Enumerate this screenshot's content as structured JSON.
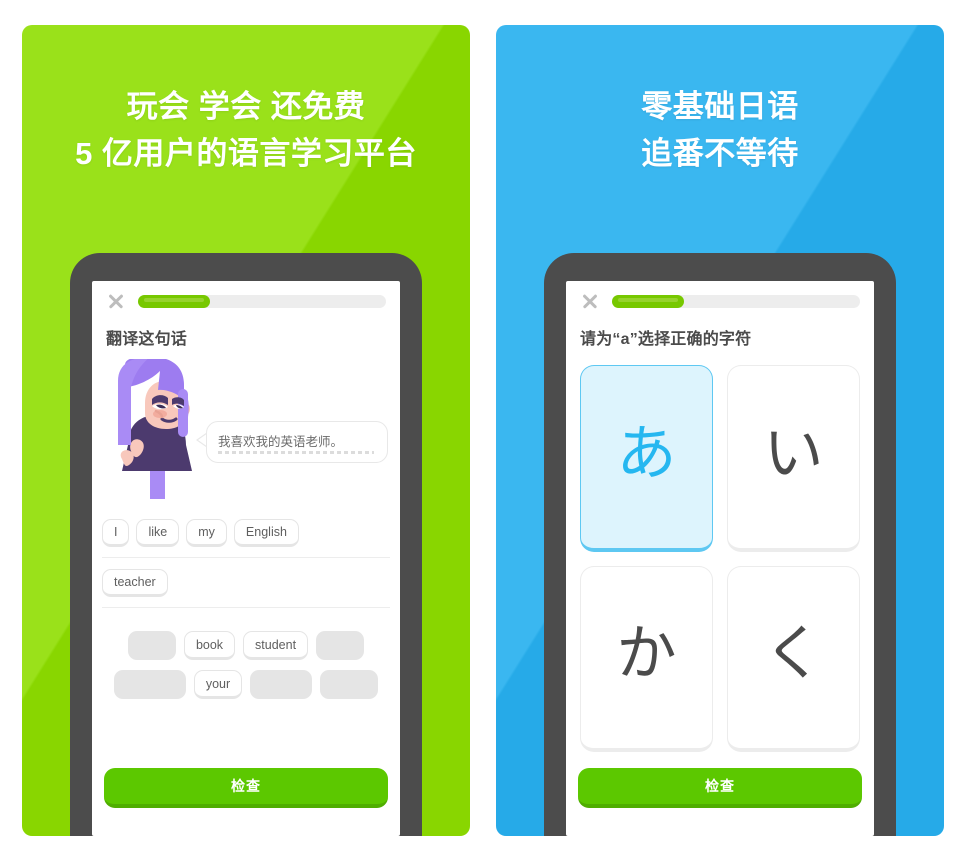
{
  "panels": [
    {
      "id": "left",
      "accent_color": "#8ede00",
      "headline_line1": "玩会 学会 还免费",
      "headline_line2": "5 亿用户的语言学习平台",
      "phone": {
        "close_icon": "close-x-icon",
        "progress_percent": 29,
        "prompt": "翻译这句话",
        "illustration": {
          "character_name": "purple-haired-character",
          "hair_color": "#a98bf5",
          "skin_color": "#f8c8bc",
          "shirt_color": "#4c3a6e",
          "speech_bubble_text": "我喜欢我的英语老师。"
        },
        "answer_rows": [
          [
            "I",
            "like",
            "my",
            "English"
          ],
          [
            "teacher"
          ]
        ],
        "word_bank_rows": [
          [
            {
              "label": "",
              "blank": true,
              "size": "w1"
            },
            {
              "label": "book",
              "blank": false
            },
            {
              "label": "student",
              "blank": false
            },
            {
              "label": "",
              "blank": true,
              "size": "w1"
            }
          ],
          [
            {
              "label": "",
              "blank": true,
              "size": "w2"
            },
            {
              "label": "your",
              "blank": false
            },
            {
              "label": "",
              "blank": true,
              "size": "w3"
            },
            {
              "label": "",
              "blank": true,
              "size": "w4"
            }
          ]
        ],
        "check_label": "检查"
      }
    },
    {
      "id": "right",
      "accent_color": "#27b0ef",
      "headline_line1": "零基础日语",
      "headline_line2": "追番不等待",
      "phone": {
        "close_icon": "close-x-icon",
        "progress_percent": 29,
        "prompt": "请为“a”选择正确的字符",
        "choices": [
          {
            "char": "あ",
            "selected": true
          },
          {
            "char": "い",
            "selected": false
          },
          {
            "char": "か",
            "selected": false
          },
          {
            "char": "く",
            "selected": false
          }
        ],
        "check_label": "检查"
      }
    }
  ],
  "colors": {
    "green_brand": "#8ede00",
    "blue_brand": "#27b0ef",
    "check_button": "#5cc800",
    "progress_fill": "#77c800",
    "selected_card_text": "#25b7f0",
    "phone_frame": "#4c4c4c"
  }
}
